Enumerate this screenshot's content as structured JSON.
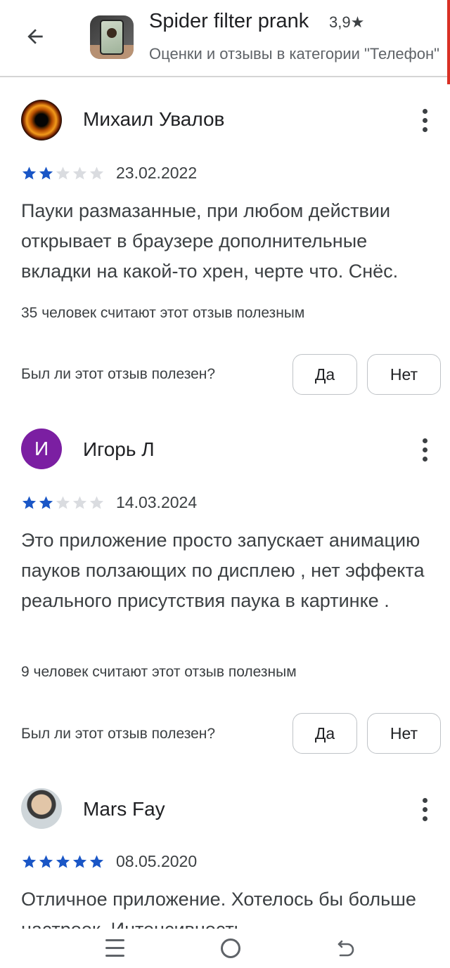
{
  "header": {
    "app_title": "Spider filter prank",
    "app_rating": "3,9★",
    "subtitle": "Оценки и отзывы в категории \"Телефон\""
  },
  "colors": {
    "star_filled": "#1a56c6",
    "star_empty": "#dadce0",
    "avatar_letter_bg": "#7b1fa2"
  },
  "reviews": [
    {
      "author": "Михаил Увалов",
      "rating": 2,
      "max_rating": 5,
      "date": "23.02.2022",
      "text": "Пауки размазанные, при любом действии открывает в браузере дополнительные вкладки на какой-то хрен, черте что. Снёс.",
      "helpful_count_text": "35 человек считают этот отзыв полезным",
      "question": "Был ли этот отзыв полезен?",
      "yes_label": "Да",
      "no_label": "Нет"
    },
    {
      "author": "Игорь Л",
      "avatar_letter": "И",
      "rating": 2,
      "max_rating": 5,
      "date": "14.03.2024",
      "text": "Это приложение просто запускает анимацию пауков ползающих по дисплею , нет эффекта реального присутствия паука в картинке .",
      "helpful_count_text": "9 человек считают этот отзыв полезным",
      "question": "Был ли этот отзыв полезен?",
      "yes_label": "Да",
      "no_label": "Нет"
    },
    {
      "author": "Mars Fay",
      "rating": 5,
      "max_rating": 5,
      "date": "08.05.2020",
      "text": "Отличное приложение. Хотелось бы больше настроек. Интенсивность"
    }
  ],
  "icons": {
    "back": "arrow-left-icon",
    "menu": "more-vert-icon",
    "nav_recent": "recent-apps-icon",
    "nav_home": "home-icon",
    "nav_back": "back-icon"
  }
}
